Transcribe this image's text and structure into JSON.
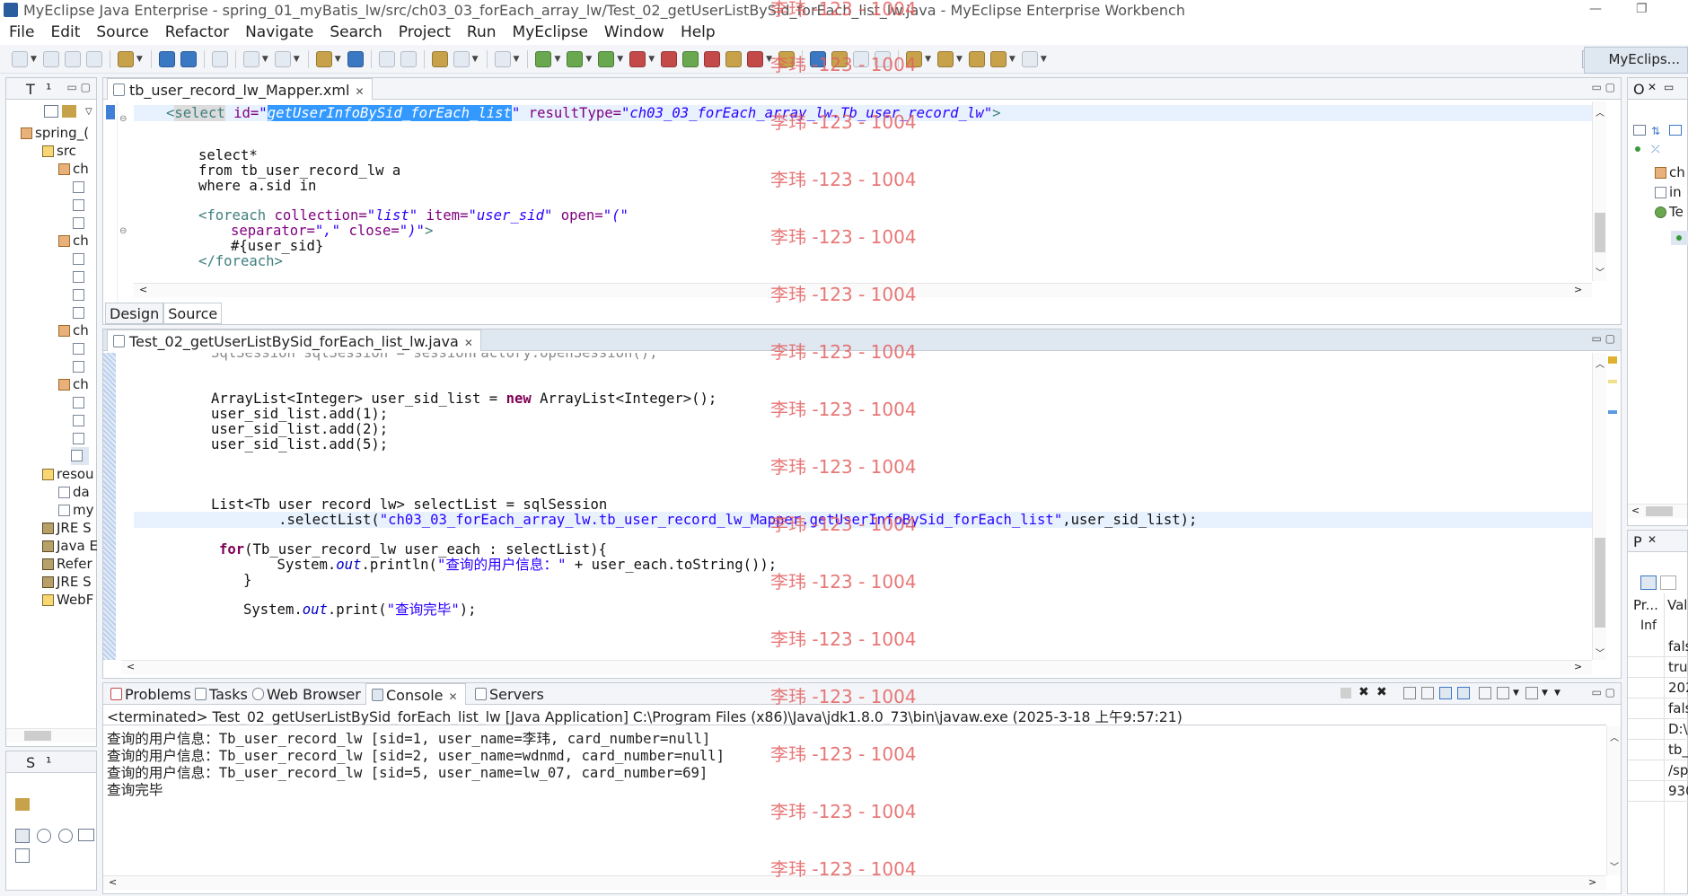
{
  "window": {
    "title": "MyEclipse Java Enterprise - spring_01_myBatis_lw/src/ch03_03_forEach_array_lw/Test_02_getUserListBySid_forEach_list_lw.java - MyEclipse Enterprise Workbench"
  },
  "menu": [
    "File",
    "Edit",
    "Source",
    "Refactor",
    "Navigate",
    "Search",
    "Project",
    "Run",
    "MyEclipse",
    "Window",
    "Help"
  ],
  "perspective": "MyEclips...",
  "left_panel": {
    "tabs": [
      "T",
      "¹"
    ],
    "tree": [
      "spring_(",
      "src",
      "ch",
      "ch",
      "ch",
      "ch",
      "resou",
      "da",
      "my",
      "JRE S",
      "Java E",
      "Refer",
      "JRE S",
      "WebF"
    ]
  },
  "left_panel2": {
    "tabs": [
      "S",
      "¹"
    ]
  },
  "xml_editor": {
    "tab_label": "tb_user_record_lw_Mapper.xml",
    "bottom_tabs": [
      "Design",
      "Source"
    ],
    "lines": {
      "l1_a": "<",
      "l1_tag": "select",
      "l1_attr1": " id=",
      "l1_q1": "\"",
      "l1_sel": "getUserInfoBySid_forEach_list",
      "l1_q2": "\"",
      "l1_attr2": " resultType=",
      "l1_val2": "\"ch03_03_forEach_array_lw.Tb_user_record_lw\"",
      "l1_end": ">",
      "l2": "select*",
      "l3": "from tb_user_record_lw a",
      "l4": "where a.sid in",
      "l5_tag": "<foreach",
      "l5_a1": " collection=",
      "l5_v1": "\"list\"",
      "l5_a2": " item=",
      "l5_v2": "\"user_sid\"",
      "l5_a3": " open=",
      "l5_v3": "\"(\"",
      "l6_a": "separator=",
      "l6_v": "\",\"",
      "l6_b": " close=",
      "l6_v2": "\")\"",
      "l6_end": ">",
      "l7": "#{user_sid}",
      "l8": "</foreach>"
    }
  },
  "java_editor": {
    "tab_label": "Test_02_getUserListBySid_forEach_list_lw.java",
    "lines": {
      "l0": "SqlSession sqlSession = sessionFactory.openSession();",
      "l1a": "ArrayList<Integer> user_sid_list = ",
      "l1k": "new",
      "l1b": " ArrayList<Integer>();",
      "l2": "user_sid_list.add(1);",
      "l3": "user_sid_list.add(2);",
      "l4": "user_sid_list.add(5);",
      "l5": "List<Tb_user_record_lw> selectList = sqlSession",
      "l6a": "        .selectList(",
      "l6s": "\"ch03_03_forEach_array_lw.tb_user_record_lw_Mapper.getUserInfoBySid_forEach_list\"",
      "l6b": ",user_sid_list);",
      "l7k": "for",
      "l7b": "(Tb_user_record_lw user_each : selectList){",
      "l8a": "    System.",
      "l8f": "out",
      "l8b": ".println(",
      "l8s": "\"查询的用户信息：\"",
      "l8c": " + user_each.toString());",
      "l9": "}",
      "l10a": "System.",
      "l10f": "out",
      "l10b": ".print(",
      "l10s": "\"查询完毕\"",
      "l10c": ");"
    }
  },
  "console": {
    "tabs": [
      "Problems",
      "Tasks",
      "Web Browser",
      "Console",
      "Servers"
    ],
    "terminated": "<terminated> Test_02_getUserListBySid_forEach_list_lw [Java Application] C:\\Program Files (x86)\\Java\\jdk1.8.0_73\\bin\\javaw.exe (2025-3-18 上午9:57:21)",
    "output": [
      "查询的用户信息：Tb_user_record_lw [sid=1, user_name=李玮, card_number=null]",
      "查询的用户信息：Tb_user_record_lw [sid=2, user_name=wdnmd, card_number=null]",
      "查询的用户信息：Tb_user_record_lw [sid=5, user_name=lw_07, card_number=69]",
      "查询完毕"
    ]
  },
  "outline_panel": {
    "tab": "O",
    "items": [
      "ch",
      "in",
      "Te"
    ]
  },
  "properties_panel": {
    "tab": "P",
    "headers": [
      "Pr...",
      "Val"
    ],
    "sub": "Inf",
    "values": [
      "fals",
      "tru",
      "202",
      "fals",
      "D:\\",
      "tb_",
      "/sp",
      "930"
    ]
  },
  "watermark": "李玮 -123 - 1004"
}
